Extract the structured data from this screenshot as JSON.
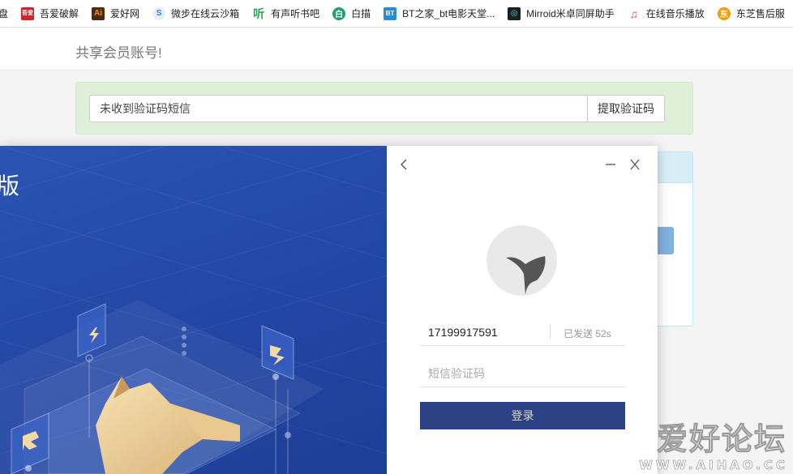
{
  "bookmarks": [
    {
      "label": "盘",
      "icon": "folder-icon",
      "color": "#f0a500"
    },
    {
      "label": "吾爱破解",
      "icon": "52pojie-icon",
      "color": "#d2232a"
    },
    {
      "label": "爱好网",
      "icon": "ai-icon",
      "color": "#f29111"
    },
    {
      "label": "微步在线云沙箱",
      "icon": "threatbook-icon",
      "color": "#3b82d6"
    },
    {
      "label": "有声听书吧",
      "icon": "ting-icon",
      "color": "#2aa64a"
    },
    {
      "label": "白描",
      "icon": "baimiao-icon",
      "color": "#1e9e6b"
    },
    {
      "label": "BT之家_bt电影天堂...",
      "icon": "bt-icon",
      "color": "#2b8ad6"
    },
    {
      "label": "Mirroid米卓同屏助手",
      "icon": "mirroid-icon",
      "color": "#1d1d1d"
    },
    {
      "label": "在线音乐播放",
      "icon": "music-icon",
      "color": "#e84c8b"
    },
    {
      "label": "东芝售后服",
      "icon": "toshiba-icon",
      "color": "#f59a00"
    }
  ],
  "page": {
    "title": "共享会员账号!",
    "sms_placeholder": "未收到验证码短信",
    "get_code_button": "提取验证码"
  },
  "modal": {
    "title_fragment": "版",
    "phone": "17199917591",
    "sent_status": "已发送 52s",
    "code_placeholder": "短信验证码",
    "login_button": "登录"
  },
  "watermark": {
    "big": "爱好论坛",
    "small": "WWW.AIHAO.CC"
  },
  "colors": {
    "alert_bg": "#dff0d8",
    "modal_blue": "#2a51ae",
    "login_btn": "#2c4286",
    "login_text": "#e8d9b5"
  }
}
